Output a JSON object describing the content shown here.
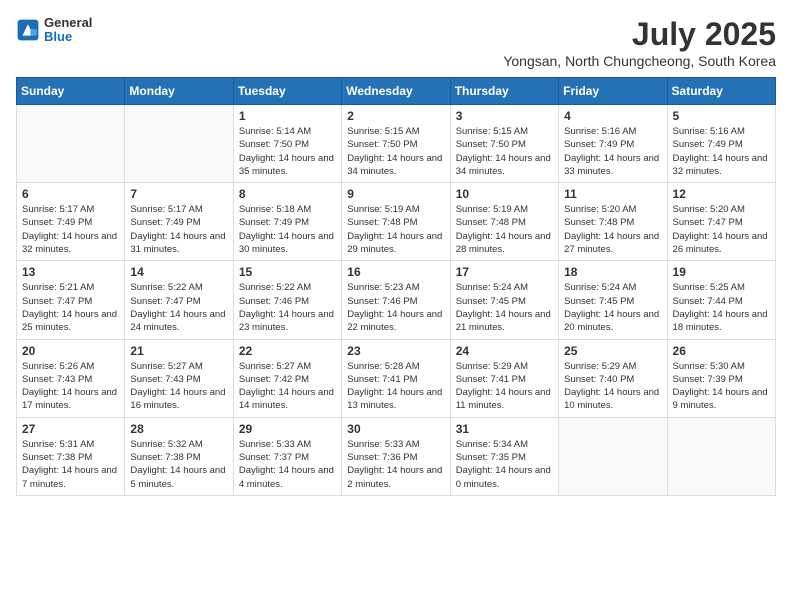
{
  "logo": {
    "line1": "General",
    "line2": "Blue"
  },
  "title": "July 2025",
  "subtitle": "Yongsan, North Chungcheong, South Korea",
  "days_of_week": [
    "Sunday",
    "Monday",
    "Tuesday",
    "Wednesday",
    "Thursday",
    "Friday",
    "Saturday"
  ],
  "weeks": [
    [
      {
        "day": "",
        "info": ""
      },
      {
        "day": "",
        "info": ""
      },
      {
        "day": "1",
        "info": "Sunrise: 5:14 AM\nSunset: 7:50 PM\nDaylight: 14 hours and 35 minutes."
      },
      {
        "day": "2",
        "info": "Sunrise: 5:15 AM\nSunset: 7:50 PM\nDaylight: 14 hours and 34 minutes."
      },
      {
        "day": "3",
        "info": "Sunrise: 5:15 AM\nSunset: 7:50 PM\nDaylight: 14 hours and 34 minutes."
      },
      {
        "day": "4",
        "info": "Sunrise: 5:16 AM\nSunset: 7:49 PM\nDaylight: 14 hours and 33 minutes."
      },
      {
        "day": "5",
        "info": "Sunrise: 5:16 AM\nSunset: 7:49 PM\nDaylight: 14 hours and 32 minutes."
      }
    ],
    [
      {
        "day": "6",
        "info": "Sunrise: 5:17 AM\nSunset: 7:49 PM\nDaylight: 14 hours and 32 minutes."
      },
      {
        "day": "7",
        "info": "Sunrise: 5:17 AM\nSunset: 7:49 PM\nDaylight: 14 hours and 31 minutes."
      },
      {
        "day": "8",
        "info": "Sunrise: 5:18 AM\nSunset: 7:49 PM\nDaylight: 14 hours and 30 minutes."
      },
      {
        "day": "9",
        "info": "Sunrise: 5:19 AM\nSunset: 7:48 PM\nDaylight: 14 hours and 29 minutes."
      },
      {
        "day": "10",
        "info": "Sunrise: 5:19 AM\nSunset: 7:48 PM\nDaylight: 14 hours and 28 minutes."
      },
      {
        "day": "11",
        "info": "Sunrise: 5:20 AM\nSunset: 7:48 PM\nDaylight: 14 hours and 27 minutes."
      },
      {
        "day": "12",
        "info": "Sunrise: 5:20 AM\nSunset: 7:47 PM\nDaylight: 14 hours and 26 minutes."
      }
    ],
    [
      {
        "day": "13",
        "info": "Sunrise: 5:21 AM\nSunset: 7:47 PM\nDaylight: 14 hours and 25 minutes."
      },
      {
        "day": "14",
        "info": "Sunrise: 5:22 AM\nSunset: 7:47 PM\nDaylight: 14 hours and 24 minutes."
      },
      {
        "day": "15",
        "info": "Sunrise: 5:22 AM\nSunset: 7:46 PM\nDaylight: 14 hours and 23 minutes."
      },
      {
        "day": "16",
        "info": "Sunrise: 5:23 AM\nSunset: 7:46 PM\nDaylight: 14 hours and 22 minutes."
      },
      {
        "day": "17",
        "info": "Sunrise: 5:24 AM\nSunset: 7:45 PM\nDaylight: 14 hours and 21 minutes."
      },
      {
        "day": "18",
        "info": "Sunrise: 5:24 AM\nSunset: 7:45 PM\nDaylight: 14 hours and 20 minutes."
      },
      {
        "day": "19",
        "info": "Sunrise: 5:25 AM\nSunset: 7:44 PM\nDaylight: 14 hours and 18 minutes."
      }
    ],
    [
      {
        "day": "20",
        "info": "Sunrise: 5:26 AM\nSunset: 7:43 PM\nDaylight: 14 hours and 17 minutes."
      },
      {
        "day": "21",
        "info": "Sunrise: 5:27 AM\nSunset: 7:43 PM\nDaylight: 14 hours and 16 minutes."
      },
      {
        "day": "22",
        "info": "Sunrise: 5:27 AM\nSunset: 7:42 PM\nDaylight: 14 hours and 14 minutes."
      },
      {
        "day": "23",
        "info": "Sunrise: 5:28 AM\nSunset: 7:41 PM\nDaylight: 14 hours and 13 minutes."
      },
      {
        "day": "24",
        "info": "Sunrise: 5:29 AM\nSunset: 7:41 PM\nDaylight: 14 hours and 11 minutes."
      },
      {
        "day": "25",
        "info": "Sunrise: 5:29 AM\nSunset: 7:40 PM\nDaylight: 14 hours and 10 minutes."
      },
      {
        "day": "26",
        "info": "Sunrise: 5:30 AM\nSunset: 7:39 PM\nDaylight: 14 hours and 9 minutes."
      }
    ],
    [
      {
        "day": "27",
        "info": "Sunrise: 5:31 AM\nSunset: 7:38 PM\nDaylight: 14 hours and 7 minutes."
      },
      {
        "day": "28",
        "info": "Sunrise: 5:32 AM\nSunset: 7:38 PM\nDaylight: 14 hours and 5 minutes."
      },
      {
        "day": "29",
        "info": "Sunrise: 5:33 AM\nSunset: 7:37 PM\nDaylight: 14 hours and 4 minutes."
      },
      {
        "day": "30",
        "info": "Sunrise: 5:33 AM\nSunset: 7:36 PM\nDaylight: 14 hours and 2 minutes."
      },
      {
        "day": "31",
        "info": "Sunrise: 5:34 AM\nSunset: 7:35 PM\nDaylight: 14 hours and 0 minutes."
      },
      {
        "day": "",
        "info": ""
      },
      {
        "day": "",
        "info": ""
      }
    ]
  ]
}
